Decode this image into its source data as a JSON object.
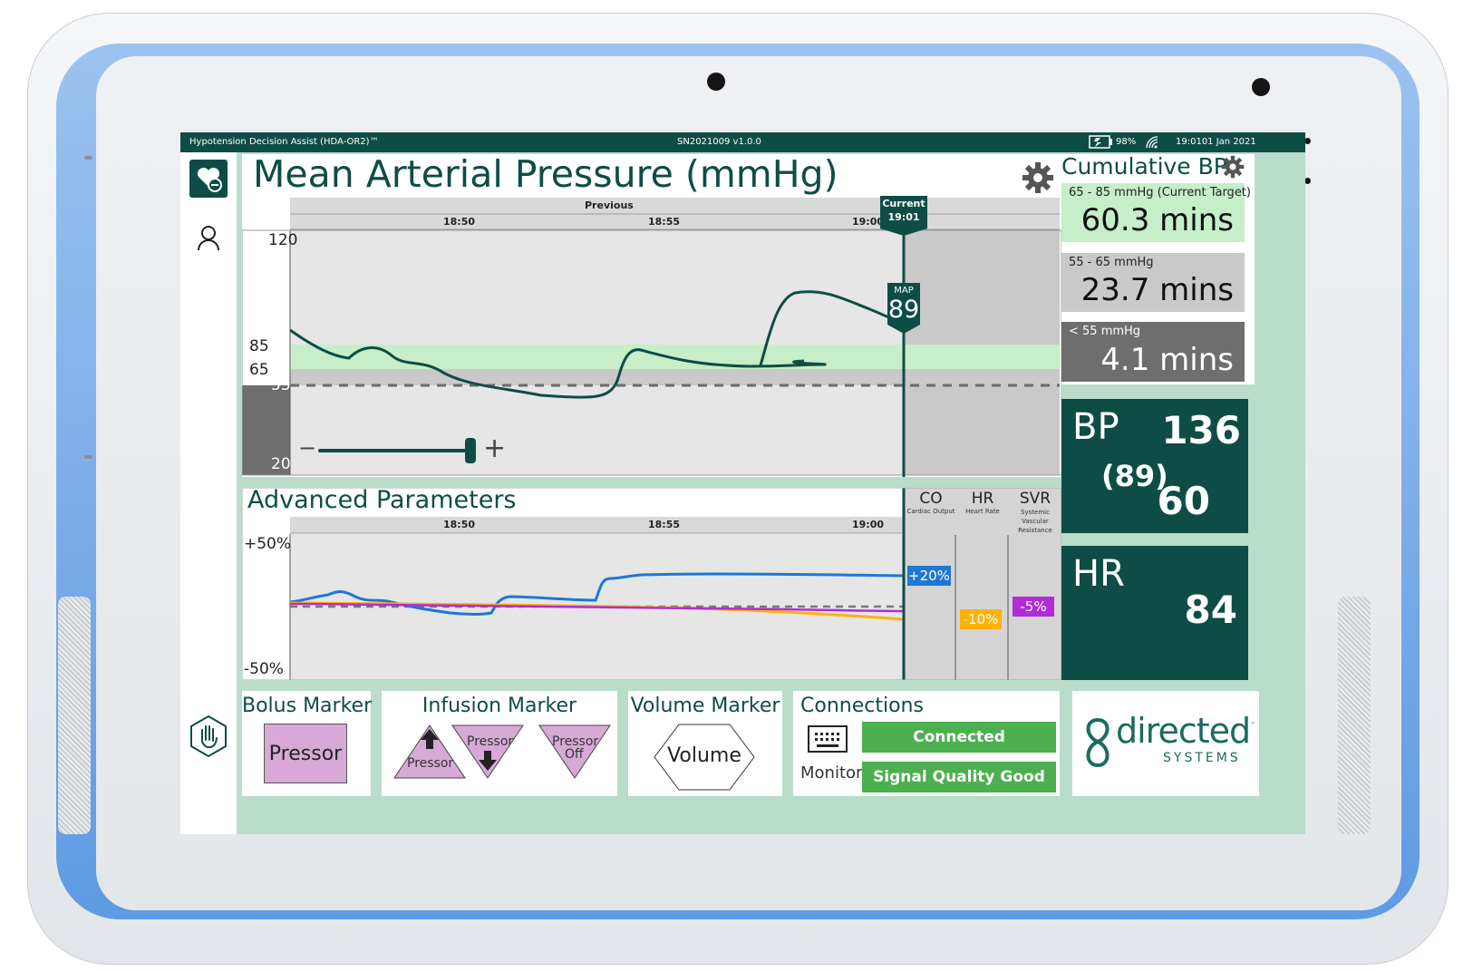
{
  "topbar": {
    "app_name": "Hypotension Decision Assist (HDA-OR2)™",
    "serial": "SN2021009 v1.0.0",
    "battery": "98%",
    "datetime": "19:0101 Jan 2021"
  },
  "map_panel": {
    "title": "Mean Arterial Pressure (mmHg)",
    "previous_label": "Previous",
    "current_label": "Current",
    "current_time": "19:01",
    "ticks": [
      "18:50",
      "18:55",
      "19:00"
    ],
    "y_ticks": [
      "120",
      "85",
      "65",
      "55",
      "20"
    ],
    "map_badge_label": "MAP",
    "map_badge_value": "89",
    "zoom_minus": "−",
    "zoom_plus": "+"
  },
  "cumulative": {
    "title": "Cumulative BP",
    "rows": [
      {
        "label": "65 - 85 mmHg (Current Target)",
        "value": "60.3 mins"
      },
      {
        "label": "55 - 65 mmHg",
        "value": "23.7 mins"
      },
      {
        "label": "< 55 mmHg",
        "value": "4.1 mins"
      }
    ]
  },
  "bp_panel": {
    "label": "BP",
    "systolic": "136",
    "mean": "(89)",
    "diastolic": "60"
  },
  "hr_panel": {
    "label": "HR",
    "value": "84"
  },
  "advanced": {
    "title": "Advanced Parameters",
    "ticks": [
      "18:50",
      "18:55",
      "19:00"
    ],
    "y_top": "+50%",
    "y_bottom": "-50%",
    "columns": [
      {
        "abbr": "CO",
        "full": "Cardiac Output",
        "change": "+20%",
        "color": "#1f77d4"
      },
      {
        "abbr": "HR",
        "full": "Heart Rate",
        "change": "-10%",
        "color": "#ffb300"
      },
      {
        "abbr": "SVR",
        "full": "Systemic Vascular Resistance",
        "change": "-5%",
        "color": "#b12cd8"
      }
    ]
  },
  "bolus": {
    "title": "Bolus Marker",
    "button": "Pressor"
  },
  "infusion": {
    "title": "Infusion Marker",
    "up": "Pressor",
    "down": "Pressor",
    "off_line1": "Pressor",
    "off_line2": "Off"
  },
  "volume": {
    "title": "Volume Marker",
    "button": "Volume"
  },
  "connections": {
    "title": "Connections",
    "device": "Monitor",
    "status": "Connected",
    "signal": "Signal Quality Good"
  },
  "brand": {
    "name": "directed",
    "sub": "SYSTEMS",
    "tm": "™"
  },
  "colors": {
    "brand_teal": "#0e4d45",
    "target_band": "#c5eec9",
    "co": "#1f77d4",
    "hr": "#ffb300",
    "svr": "#b12cd8",
    "marker_pink": "#d7a9d6"
  }
}
